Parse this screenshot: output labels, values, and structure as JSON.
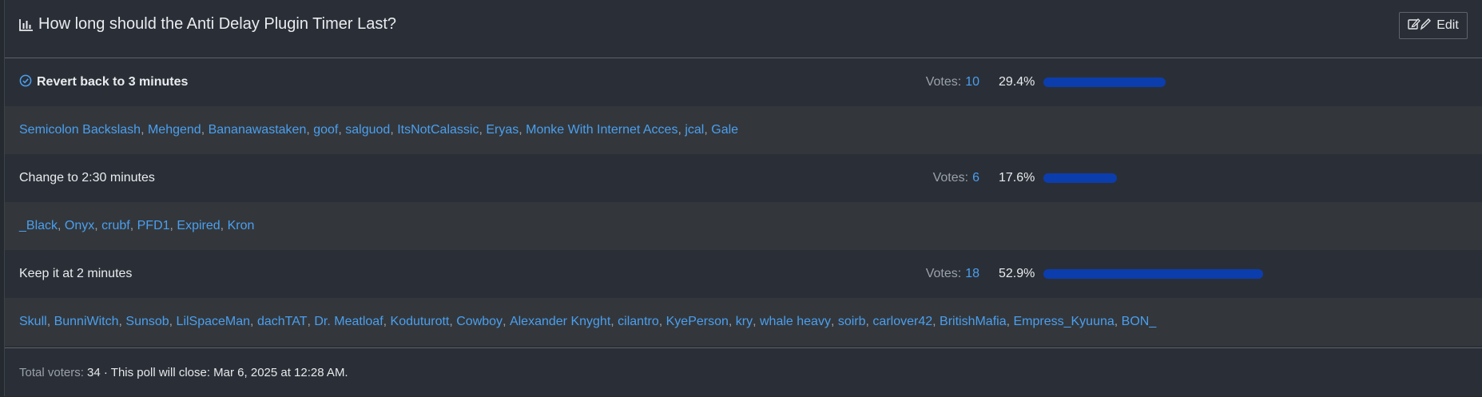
{
  "poll": {
    "title": "How long should the Anti Delay Plugin Timer Last?",
    "title_icon": "bar-chart-icon",
    "edit_label": "Edit",
    "edit_icon": "edit-icon",
    "votes_label": "Votes:",
    "options": [
      {
        "label": "Revert back to 3 minutes",
        "voted": true,
        "votes": "10",
        "percent_text": "29.4%",
        "percent": 29.4,
        "voters": [
          "Semicolon Backslash",
          "Mehgend",
          "Bananawastaken",
          "goof",
          "salguod",
          "ItsNotCalassic",
          "Eryas",
          "Monke With Internet Acces",
          "jcal",
          "Gale"
        ]
      },
      {
        "label": "Change to 2:30 minutes",
        "voted": false,
        "votes": "6",
        "percent_text": "17.6%",
        "percent": 17.6,
        "voters": [
          "_Black",
          "Onyx",
          "crubf",
          "PFD1",
          "Expired",
          "Kron"
        ]
      },
      {
        "label": "Keep it at 2 minutes",
        "voted": false,
        "votes": "18",
        "percent_text": "52.9%",
        "percent": 52.9,
        "voters": [
          "Skull",
          "BunniWitch",
          "Sunsob",
          "LilSpaceMan",
          "dachTAT",
          "Dr. Meatloaf",
          "Koduturott",
          "Cowboy",
          "Alexander Knyght",
          "cilantro",
          "KyePerson",
          "kry",
          "whale heavy",
          "soirb",
          "carlover42",
          "BritishMafia",
          "Empress_Kyuuna",
          "BON_"
        ]
      }
    ],
    "footer": {
      "total_label": "Total voters:",
      "total_value": "34",
      "close_text": "· This poll will close: Mar 6, 2025 at 12:28 AM."
    },
    "colors": {
      "background": "#2a2f37",
      "alt_row": "#33373b",
      "link": "#4b9ff0",
      "bar": "#0c3dad"
    }
  }
}
